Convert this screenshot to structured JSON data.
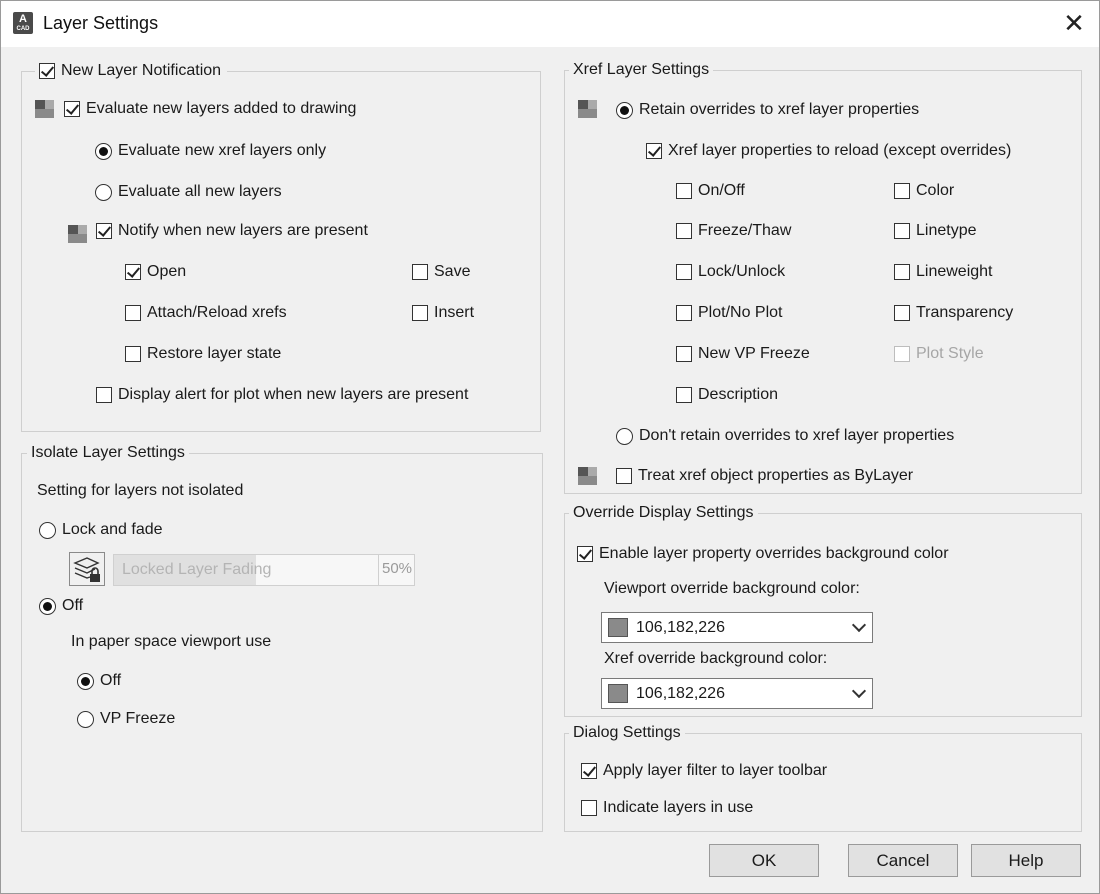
{
  "window": {
    "title": "Layer Settings",
    "app_icon_letter": "A",
    "app_icon_sub": "CAD"
  },
  "new_layer": {
    "legend": "New Layer Notification",
    "evaluate": "Evaluate new layers added to drawing",
    "xref_only": "Evaluate new xref layers only",
    "all_new": "Evaluate all new layers",
    "notify": "Notify when new layers are present",
    "open": "Open",
    "save": "Save",
    "attach": "Attach/Reload xrefs",
    "insert": "Insert",
    "restore": "Restore layer state",
    "plot_alert": "Display alert for plot when new layers are present"
  },
  "isolate": {
    "legend": "Isolate Layer Settings",
    "setting_label": "Setting for layers not isolated",
    "lock_fade": "Lock and fade",
    "fading_label": "Locked Layer Fading",
    "fading_value": "50%",
    "fading_level": 0.5,
    "off": "Off",
    "paper_space_label": "In paper space viewport use",
    "ps_off": "Off",
    "ps_vp_freeze": "VP Freeze"
  },
  "xref": {
    "legend": "Xref Layer Settings",
    "retain": "Retain overrides to xref layer properties",
    "reload": "Xref layer properties to reload (except overrides)",
    "props_left": [
      "On/Off",
      "Freeze/Thaw",
      "Lock/Unlock",
      "Plot/No Plot",
      "New VP Freeze",
      "Description"
    ],
    "props_right": [
      "Color",
      "Linetype",
      "Lineweight",
      "Transparency",
      "Plot Style"
    ],
    "dont_retain": "Don't retain overrides to xref layer properties",
    "bylayer": "Treat xref object properties as ByLayer"
  },
  "override": {
    "legend": "Override Display Settings",
    "enable": "Enable layer property overrides background color",
    "viewport_label": "Viewport override background color:",
    "viewport_value": "106,182,226",
    "xref_label": "Xref override background color:",
    "xref_value": "106,182,226"
  },
  "dialog": {
    "legend": "Dialog Settings",
    "apply_filter": "Apply layer filter to layer toolbar",
    "indicate": "Indicate layers in use"
  },
  "buttons": {
    "ok": "OK",
    "cancel": "Cancel",
    "help": "Help"
  }
}
